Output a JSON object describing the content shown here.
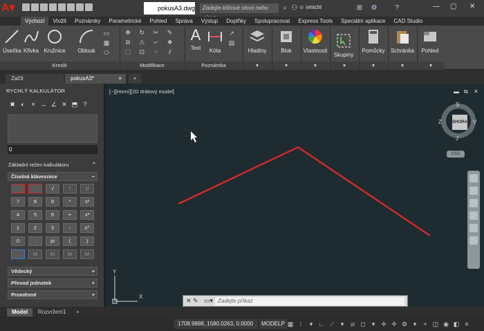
{
  "title": {
    "filename": "pokusA3.dwg",
    "search_placeholder": "Zadejte klíčové slovo nebo výraz.",
    "user": "vmichl",
    "minimize": "—",
    "maximize": "▢",
    "close": "✕"
  },
  "ribbon_tabs": [
    "Výchozí",
    "Vložit",
    "Poznámky",
    "Parametrické",
    "Pohled",
    "Správa",
    "Výstup",
    "Doplňky",
    "Spolupracovat",
    "Express Tools",
    "Speciální aplikace",
    "CAD Studio"
  ],
  "ribbon": {
    "draw": {
      "line": "Úsečka",
      "polyline": "Křivka",
      "circle": "Kružnice",
      "arc": "Oblouk",
      "panel": "Kreslit"
    },
    "modify_panel": "Modifikace",
    "annotation": {
      "text": "Text",
      "dim": "Kóta",
      "panel": "Poznámka"
    },
    "layers": "Hladiny",
    "block": "Blok",
    "properties": "Vlastnosti",
    "groups": "Skupiny",
    "utilities": "Pomůcky",
    "clipboard": "Schránka",
    "view": "Pohled"
  },
  "file_tabs": {
    "start": "Začít",
    "active": "pokusA3*",
    "add": "+",
    "close": "×"
  },
  "calculator": {
    "title": "RYCHLÝ KALKULÁTOR",
    "value": "0",
    "mode": "Základní režim kalkulátoru",
    "keypad_title": "Číselná klávesnice",
    "keys": [
      [
        "",
        "",
        "√",
        "/",
        "1/"
      ],
      [
        "7",
        "8",
        "9",
        "*",
        "x²"
      ],
      [
        "4",
        "5",
        "6",
        "+",
        "x³"
      ],
      [
        "1",
        "2",
        "3",
        "-",
        "x^"
      ],
      [
        "0",
        ".",
        "pi",
        "(",
        ")"
      ],
      [
        "",
        "M",
        "M",
        "M",
        "M"
      ]
    ],
    "sections": [
      "Vědecký",
      "Převod jednotek",
      "Proměnné"
    ]
  },
  "viewport": {
    "label": "[−][Horní][2D drátový model]",
    "viewcube": {
      "face": "SHORA",
      "n": "S",
      "s": "J",
      "e": "V",
      "w": "Z"
    },
    "wcs": "GSS",
    "command_placeholder": "Zadejte příkaz",
    "ucs_x": "X",
    "ucs_y": "Y"
  },
  "layout_tabs": {
    "model": "Model",
    "layout": "Rozvržení1",
    "add": "+"
  },
  "status": {
    "coords": "1708.9898, 1580.0263, 0.0000",
    "space": "MODELP"
  },
  "colors": {
    "accent_red": "#d42a2a",
    "background": "#1e2b30",
    "ribbon": "#4a4a4a"
  }
}
